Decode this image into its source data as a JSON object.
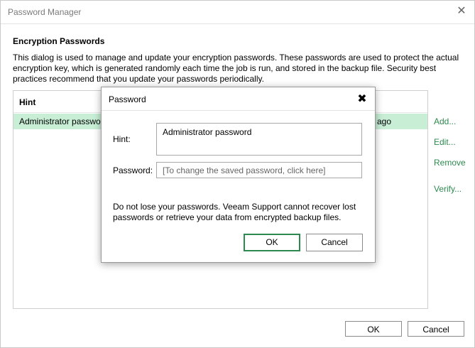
{
  "window": {
    "title": "Password Manager",
    "close_glyph": "✕"
  },
  "section": {
    "title": "Encryption Passwords",
    "description": "This dialog is used to manage and update your encryption passwords. These passwords are used to protect the actual encryption key, which is generated randomly each time the job is run, and stored in the backup file. Security best practices recommend that you update your passwords periodically."
  },
  "list": {
    "header_hint": "Hint",
    "rows": [
      {
        "hint": "Administrator password",
        "modified": "ago"
      }
    ]
  },
  "actions": {
    "add": "Add...",
    "edit": "Edit...",
    "remove": "Remove",
    "verify": "Verify..."
  },
  "footer": {
    "ok": "OK",
    "cancel": "Cancel"
  },
  "dialog": {
    "title": "Password",
    "close_glyph": "✖",
    "hint_label": "Hint:",
    "hint_value": "Administrator password",
    "password_label": "Password:",
    "password_placeholder": "[To change the saved password, click here]",
    "warning": "Do not lose your passwords. Veeam Support cannot recover lost passwords or retrieve your data from encrypted backup files.",
    "ok": "OK",
    "cancel": "Cancel"
  },
  "colors": {
    "accent": "#2d8a4e",
    "selected_row": "#c8eed6"
  }
}
